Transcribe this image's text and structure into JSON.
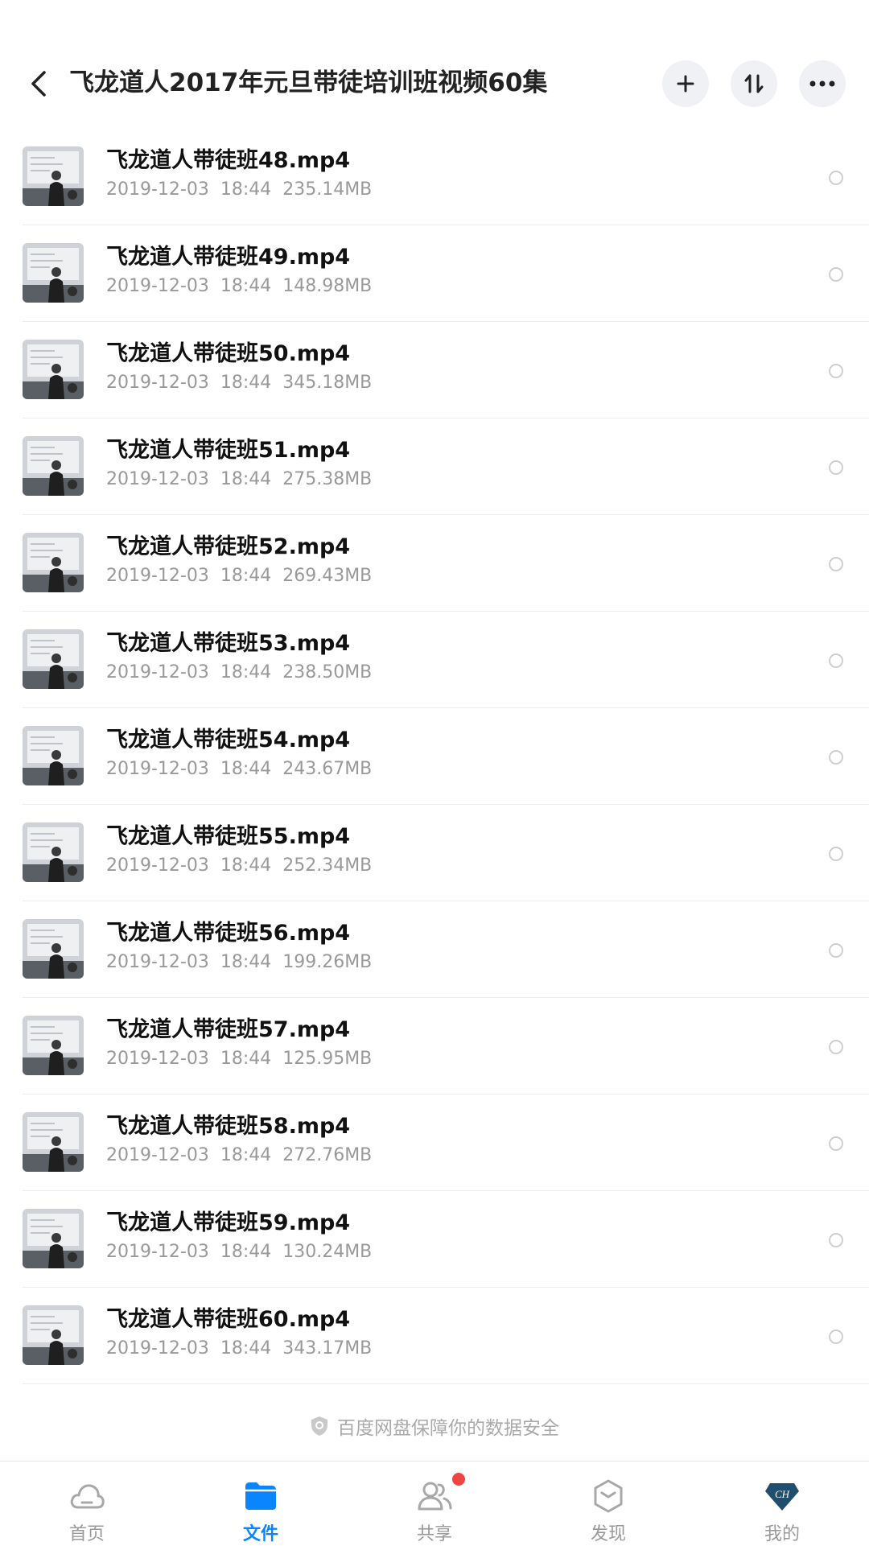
{
  "header": {
    "title": "飞龙道人2017年元旦带徒培训班视频60集",
    "back_icon": "chevron-left-icon",
    "add_icon": "plus-icon",
    "sort_icon": "sort-icon",
    "more_icon": "more-icon"
  },
  "files": [
    {
      "name": "飞龙道人带徒班48.mp4",
      "date": "2019-12-03",
      "time": "18:44",
      "size": "235.14MB"
    },
    {
      "name": "飞龙道人带徒班49.mp4",
      "date": "2019-12-03",
      "time": "18:44",
      "size": "148.98MB"
    },
    {
      "name": "飞龙道人带徒班50.mp4",
      "date": "2019-12-03",
      "time": "18:44",
      "size": "345.18MB"
    },
    {
      "name": "飞龙道人带徒班51.mp4",
      "date": "2019-12-03",
      "time": "18:44",
      "size": "275.38MB"
    },
    {
      "name": "飞龙道人带徒班52.mp4",
      "date": "2019-12-03",
      "time": "18:44",
      "size": "269.43MB"
    },
    {
      "name": "飞龙道人带徒班53.mp4",
      "date": "2019-12-03",
      "time": "18:44",
      "size": "238.50MB"
    },
    {
      "name": "飞龙道人带徒班54.mp4",
      "date": "2019-12-03",
      "time": "18:44",
      "size": "243.67MB"
    },
    {
      "name": "飞龙道人带徒班55.mp4",
      "date": "2019-12-03",
      "time": "18:44",
      "size": "252.34MB"
    },
    {
      "name": "飞龙道人带徒班56.mp4",
      "date": "2019-12-03",
      "time": "18:44",
      "size": "199.26MB"
    },
    {
      "name": "飞龙道人带徒班57.mp4",
      "date": "2019-12-03",
      "time": "18:44",
      "size": "125.95MB"
    },
    {
      "name": "飞龙道人带徒班58.mp4",
      "date": "2019-12-03",
      "time": "18:44",
      "size": "272.76MB"
    },
    {
      "name": "飞龙道人带徒班59.mp4",
      "date": "2019-12-03",
      "time": "18:44",
      "size": "130.24MB"
    },
    {
      "name": "飞龙道人带徒班60.mp4",
      "date": "2019-12-03",
      "time": "18:44",
      "size": "343.17MB"
    }
  ],
  "footer_note": "百度网盘保障你的数据安全",
  "tabs": [
    {
      "label": "首页",
      "icon": "cloud-icon",
      "active": false
    },
    {
      "label": "文件",
      "icon": "folder-icon",
      "active": true
    },
    {
      "label": "共享",
      "icon": "people-icon",
      "active": false,
      "badge": true
    },
    {
      "label": "发现",
      "icon": "discover-icon",
      "active": false
    },
    {
      "label": "我的",
      "icon": "avatar-icon",
      "active": false,
      "avatar_text": "CH"
    }
  ],
  "colors": {
    "accent": "#0a84ff",
    "badge": "#f04444"
  }
}
